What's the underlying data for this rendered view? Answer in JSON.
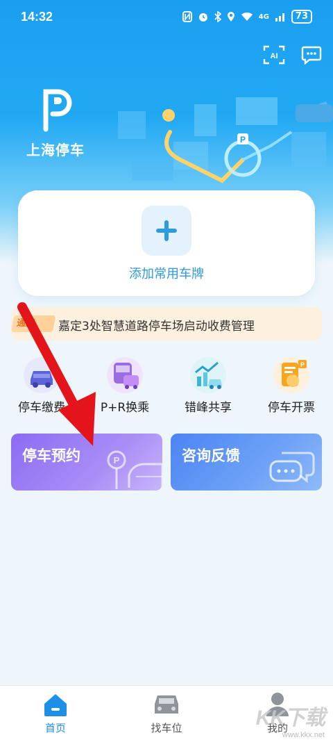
{
  "status_bar": {
    "time": "14:32",
    "icons": [
      "nfc-icon",
      "alarm-icon",
      "bluetooth-icon",
      "location-icon",
      "wifi-icon",
      "signal-icon"
    ],
    "network": "4G",
    "battery": "73"
  },
  "header": {
    "app_name": "上海停车",
    "ai_scan_label": "AI",
    "colors": {
      "brand": "#1a9ff0"
    }
  },
  "plate": {
    "add_label": "添加常用车牌"
  },
  "notice": {
    "tag": "通知",
    "text": "嘉定3处智慧道路停车场启动收费管理"
  },
  "quick_actions": [
    {
      "label": "停车缴费",
      "icon": "car-payment-icon"
    },
    {
      "label": "P+R换乘",
      "icon": "bus-transfer-icon"
    },
    {
      "label": "错峰共享",
      "icon": "off-peak-share-icon"
    },
    {
      "label": "停车开票",
      "icon": "parking-invoice-icon"
    }
  ],
  "cards": {
    "reservation": "停车预约",
    "feedback": "咨询反馈"
  },
  "tabbar": {
    "tabs": [
      {
        "label": "首页",
        "active": true
      },
      {
        "label": "找车位",
        "active": false
      },
      {
        "label": "我的",
        "active": false
      }
    ],
    "active_color": "#1d8fe6"
  },
  "watermark": {
    "brand": "KK下载",
    "url": "www.kkx.net"
  }
}
